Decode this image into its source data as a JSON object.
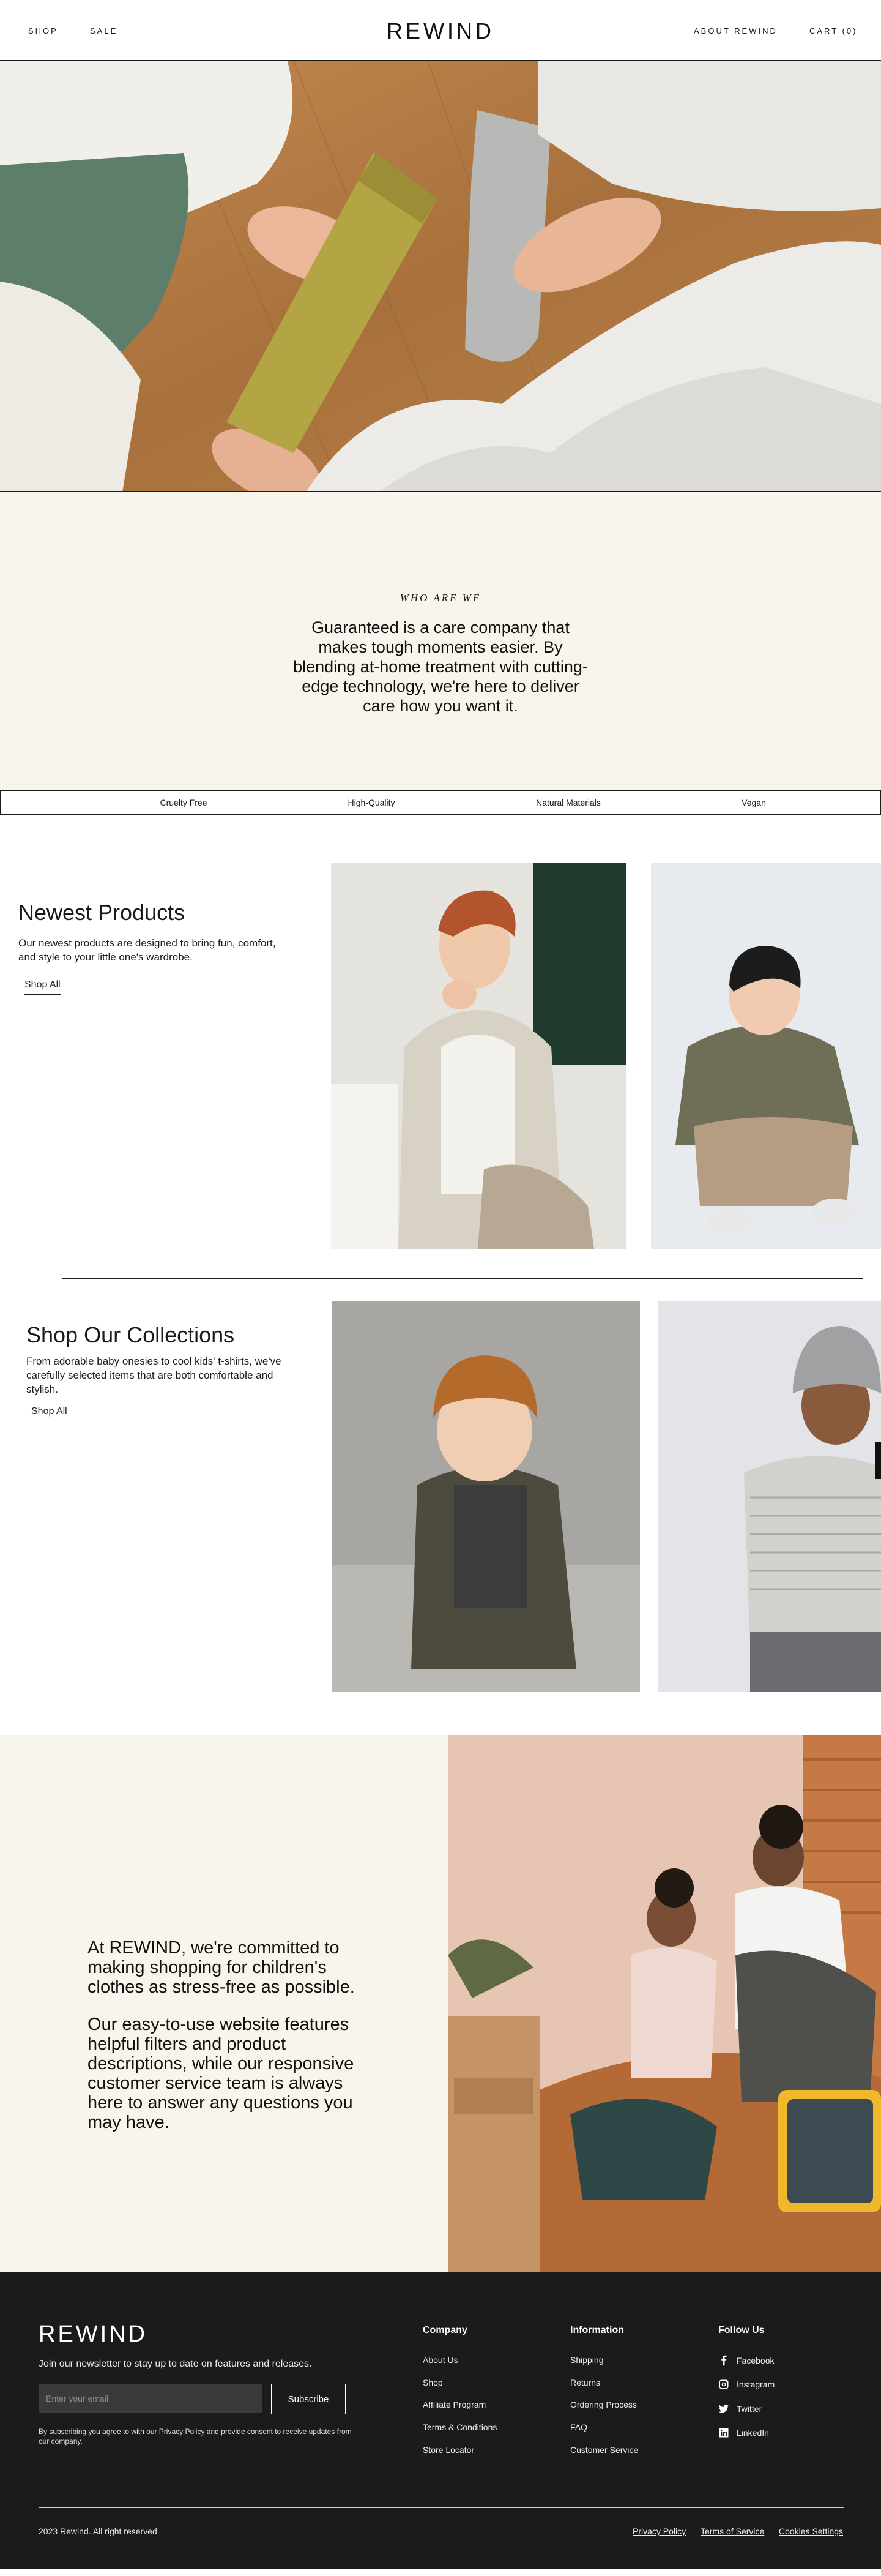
{
  "header": {
    "logo": "REWIND",
    "nav_left": [
      "SHOP",
      "SALE"
    ],
    "about": "ABOUT REWIND",
    "cart": "CART (0)"
  },
  "about": {
    "eyebrow": "WHO ARE WE",
    "text": "Guaranteed is a care company that makes tough moments easier. By blending at-home treatment with cutting-edge technology, we're here to deliver care how you want it."
  },
  "features": [
    "Cruelty Free",
    "High-Quality",
    "Natural Materials",
    "Vegan"
  ],
  "products": {
    "title": "Newest Products",
    "description": " Our newest products are designed to bring fun, comfort, and style to your little one's wardrobe.",
    "cta": "Shop All"
  },
  "collections": {
    "title": "Shop Our Collections",
    "description": "From adorable baby onesies to cool kids' t-shirts, we've carefully selected items that are both comfortable and stylish.",
    "cta": "Shop All"
  },
  "commitment": {
    "paragraph1": "At REWIND, we're committed to making shopping for children's clothes as stress-free as possible.",
    "paragraph2": " Our easy-to-use website features helpful filters and product descriptions, while our responsive customer service team is always here to answer any questions you may have."
  },
  "footer": {
    "logo": "REWIND",
    "newsletter": "Join our newsletter to stay up to date on features and releases.",
    "email_placeholder": "Enter your email",
    "subscribe": "Subscribe",
    "consent_before": "By subscribing you agree to with our ",
    "consent_link": "Privacy Policy",
    "consent_after": " and provide consent to receive updates from our company.",
    "columns": [
      {
        "title": "Company",
        "links": [
          "About Us",
          "Shop",
          "Affiliate Program",
          "Terms & Conditions",
          "Store Locator"
        ]
      },
      {
        "title": "Information",
        "links": [
          "Shipping",
          "Returns",
          "Ordering Process",
          "FAQ",
          "Customer Service"
        ]
      }
    ],
    "follow": {
      "title": "Follow Us",
      "links": [
        {
          "label": "Facebook",
          "icon": "facebook-icon"
        },
        {
          "label": "Instagram",
          "icon": "instagram-icon"
        },
        {
          "label": "Twitter",
          "icon": "twitter-icon"
        },
        {
          "label": "LinkedIn",
          "icon": "linkedin-icon"
        }
      ]
    },
    "copyright": "2023 Rewind. All right reserved.",
    "legal": [
      "Privacy Policy",
      "Terms of Service",
      "Cookies Settings"
    ]
  },
  "colors": {
    "cream": "#f8f5ec",
    "footer_bg": "#1b1b1b",
    "ink": "#1a1a1a"
  }
}
